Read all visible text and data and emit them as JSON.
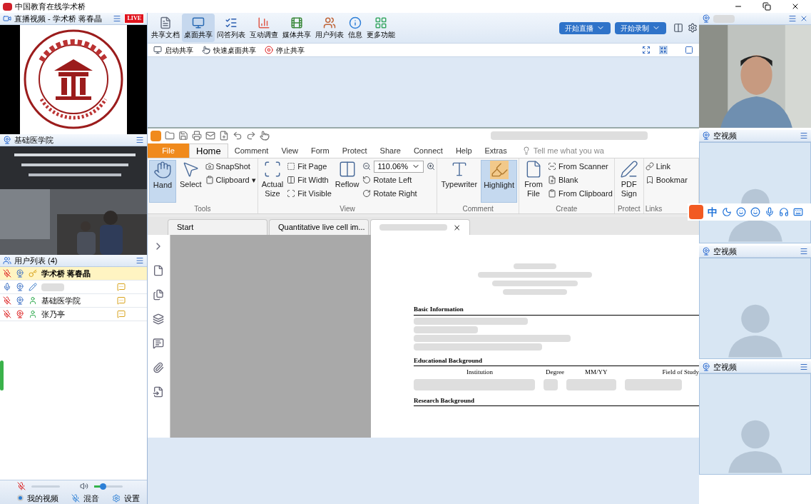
{
  "app_title": "中国教育在线学术桥",
  "left_panel": {
    "live_video": {
      "title": "直播视频 - 学术桥 蒋春晶",
      "badge": "LIVE"
    },
    "class_video": {
      "title": "基础医学院"
    },
    "user_list": {
      "title": "用户列表 (4)",
      "users": [
        {
          "name": "学术桥 蒋春晶",
          "selected": true,
          "kind": "host",
          "mic_muted": true,
          "camera_off": false,
          "chat": false
        },
        {
          "selected": false,
          "kind": "presenter",
          "mic_muted": false,
          "camera_off": false,
          "chat": true
        },
        {
          "name": "基础医学院",
          "selected": false,
          "kind": "user",
          "mic_muted": true,
          "camera_off": false,
          "chat": true
        },
        {
          "name": "张乃亭",
          "selected": false,
          "kind": "user",
          "mic_muted": true,
          "camera_off": true,
          "chat": true
        }
      ]
    },
    "speaker_volume": {
      "level": 0.3
    },
    "bottom_buttons": [
      {
        "label": "我的视频",
        "kind": "radio"
      },
      {
        "label": "混音",
        "kind": "mix"
      },
      {
        "label": "设置",
        "kind": "settings"
      }
    ]
  },
  "toolbar": {
    "tools": [
      {
        "label": "共享文档",
        "selected": false
      },
      {
        "label": "桌面共享",
        "selected": true
      },
      {
        "label": "问答列表",
        "selected": false
      },
      {
        "label": "互动调查",
        "selected": false
      },
      {
        "label": "媒体共享",
        "selected": false
      },
      {
        "label": "用户列表",
        "selected": false
      },
      {
        "label": "信息",
        "selected": false
      },
      {
        "label": "更多功能",
        "selected": false
      }
    ],
    "action_buttons": [
      "开始直播",
      "开始录制"
    ]
  },
  "share_bar": [
    "启动共享",
    "快速桌面共享",
    "停止共享"
  ],
  "pdf_app": {
    "tabs": [
      {
        "label": "File",
        "kind": "file",
        "selected": false
      },
      {
        "label": "Home",
        "selected": true
      },
      {
        "label": "Comment",
        "selected": false
      },
      {
        "label": "View",
        "selected": false
      },
      {
        "label": "Form",
        "selected": false
      },
      {
        "label": "Protect",
        "selected": false
      },
      {
        "label": "Share",
        "selected": false
      },
      {
        "label": "Connect",
        "selected": false
      },
      {
        "label": "Help",
        "selected": false
      },
      {
        "label": "Extras",
        "selected": false
      }
    ],
    "search": {
      "placeholder": "Tell me what you wa"
    },
    "ribbon": [
      {
        "label": "Tools",
        "items": [
          {
            "kind": "large",
            "label": "Hand",
            "selected": true
          },
          {
            "kind": "large",
            "label": "Select",
            "selected": false
          },
          {
            "kind": "column",
            "items": [
              "SnapShot",
              "Clipboard ▾"
            ]
          }
        ]
      },
      {
        "label": "View",
        "items": [
          {
            "kind": "large",
            "label": "Actual Size",
            "selected": false
          },
          {
            "kind": "column",
            "items": [
              "Fit Page",
              "Fit Width",
              "Fit Visible"
            ]
          },
          {
            "kind": "large",
            "label": "Reflow",
            "selected": false
          },
          {
            "kind": "zoom",
            "value": "110.06%",
            "items": [
              "Rotate Left",
              "Rotate Right"
            ]
          }
        ]
      },
      {
        "label": "Comment",
        "items": [
          {
            "kind": "large",
            "label": "Typewriter",
            "selected": false
          },
          {
            "kind": "large",
            "label": "Highlight",
            "selected": true
          }
        ]
      },
      {
        "label": "Create",
        "items": [
          {
            "kind": "large",
            "label": "From File",
            "selected": false
          },
          {
            "kind": "column",
            "items": [
              "From Scanner",
              "Blank",
              "From Clipboard"
            ]
          }
        ]
      },
      {
        "label": "Protect",
        "items": [
          {
            "kind": "large",
            "label": "PDF Sign",
            "selected": false
          }
        ]
      },
      {
        "label": "Links",
        "items": [
          {
            "kind": "column",
            "items": [
              "Link",
              "Bookmar"
            ]
          }
        ]
      }
    ],
    "doc_tabs": [
      {
        "label": "Start",
        "selected": false
      },
      {
        "label": "Quantitative live cell im...",
        "selected": false
      },
      {
        "selected": true,
        "closable": true
      }
    ],
    "document": {
      "sections": [
        {
          "heading": "Basic Information"
        },
        {
          "heading": "Educational Background",
          "columns": [
            "Institution",
            "Degree",
            "MM/YY",
            "Field of Study"
          ]
        },
        {
          "heading": "Research Background"
        }
      ]
    }
  },
  "video_tiles": [
    {
      "kind": "camera"
    },
    {
      "kind": "empty",
      "title": "空视频"
    },
    {
      "kind": "empty",
      "title": "空视频"
    },
    {
      "kind": "empty",
      "title": "空视频"
    }
  ],
  "ime_toolbar": {
    "mode": "中"
  }
}
